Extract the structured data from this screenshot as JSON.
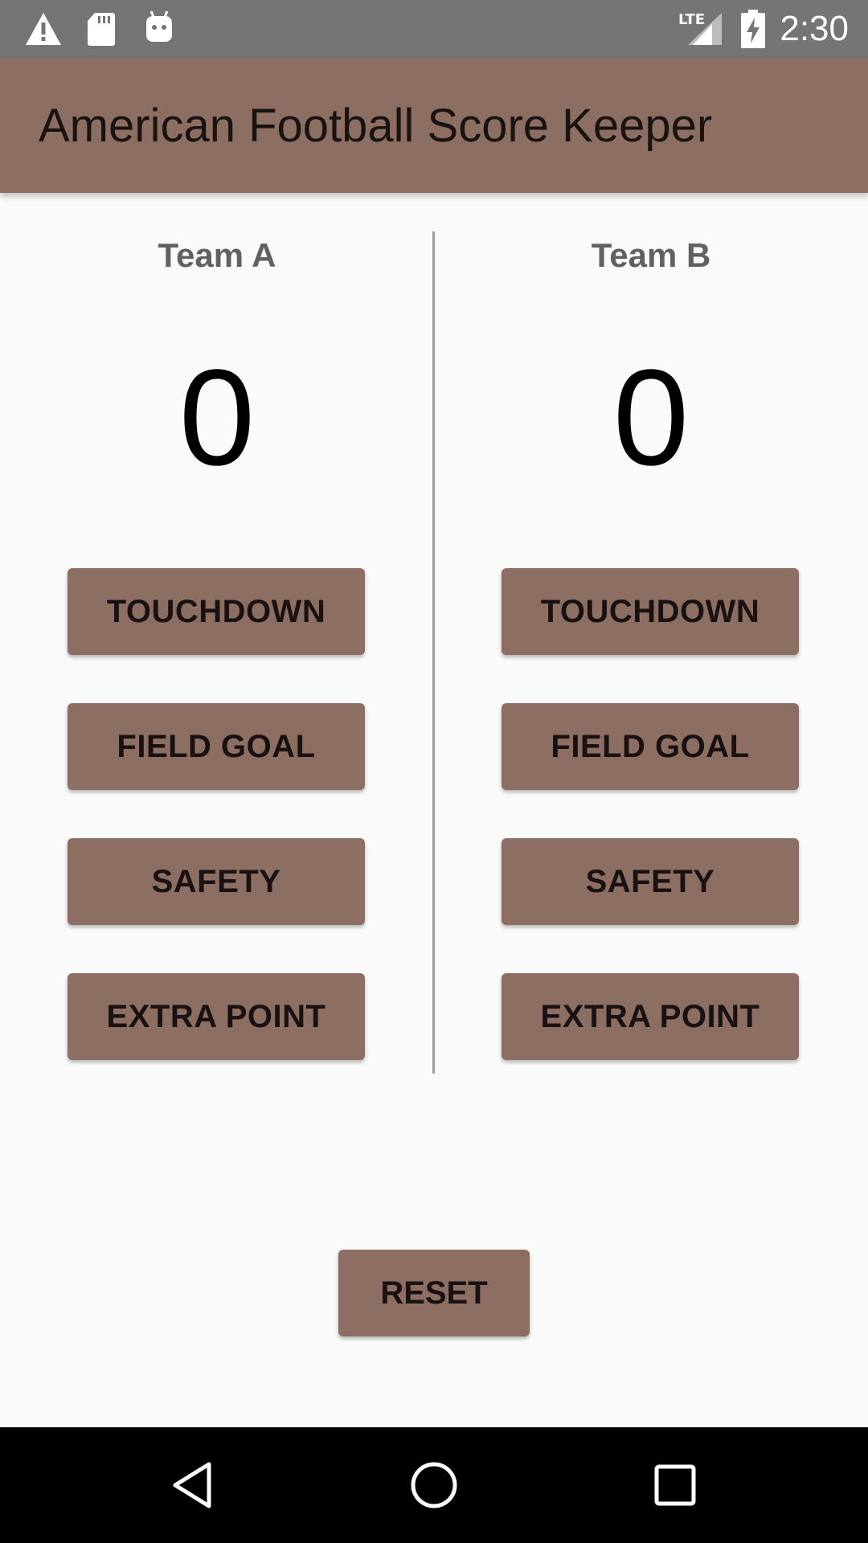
{
  "status_bar": {
    "time": "2:30",
    "network": "LTE",
    "icons": [
      "warning-icon",
      "sd-card-icon",
      "android-icon",
      "signal-icon",
      "battery-charging-icon"
    ]
  },
  "app_bar": {
    "title": "American Football Score Keeper"
  },
  "team_a": {
    "name": "Team A",
    "score": "0",
    "buttons": [
      "TOUCHDOWN",
      "FIELD GOAL",
      "SAFETY",
      "EXTRA POINT"
    ]
  },
  "team_b": {
    "name": "Team B",
    "score": "0",
    "buttons": [
      "TOUCHDOWN",
      "FIELD GOAL",
      "SAFETY",
      "EXTRA POINT"
    ]
  },
  "reset_label": "RESET",
  "nav_bar": {
    "icons": [
      "back-icon",
      "home-icon",
      "recents-icon"
    ]
  },
  "colors": {
    "primary": "#8d6e63",
    "status_bar": "#757575",
    "background": "#fafafa"
  }
}
